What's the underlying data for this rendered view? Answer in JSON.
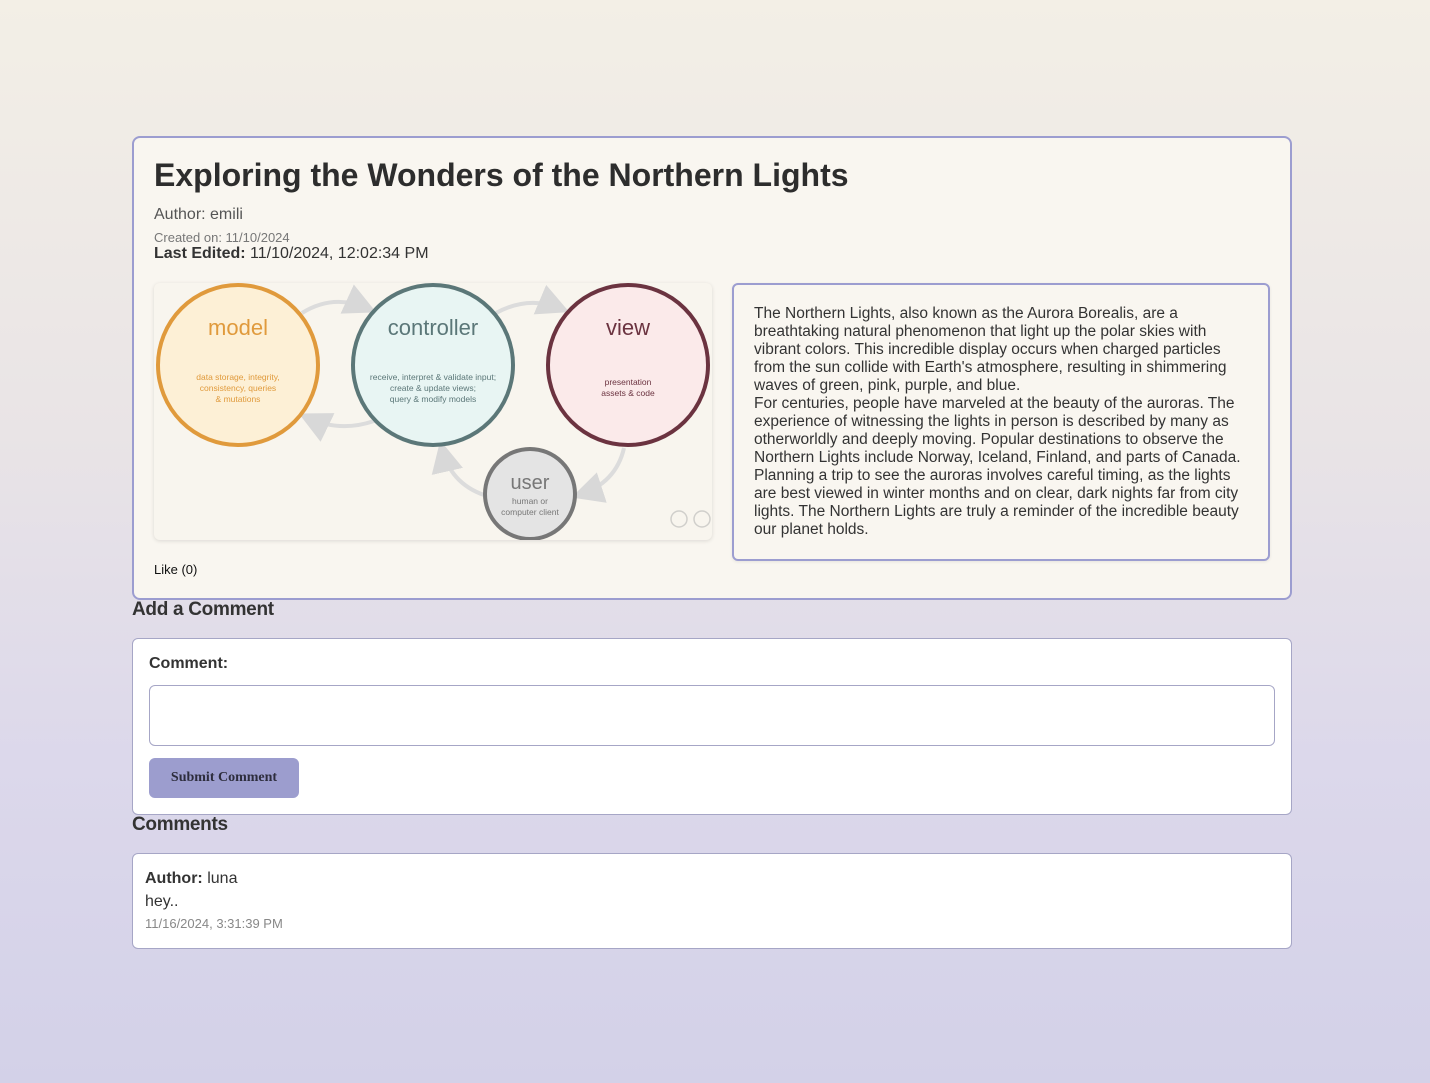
{
  "post": {
    "title": "Exploring the Wonders of the Northern Lights",
    "author": "Author: emili",
    "created": "Created on: 11/10/2024",
    "edited_label": "Last Edited:",
    "edited_value": "11/10/2024, 12:02:34 PM",
    "like_label": "Like (0)",
    "paragraphs": [
      "The Northern Lights, also known as the Aurora Borealis, are a breathtaking natural phenomenon that light up the polar skies with vibrant colors. This incredible display occurs when charged particles from the sun collide with Earth's atmosphere, resulting in shimmering waves of green, pink, purple, and blue.",
      "For centuries, people have marveled at the beauty of the auroras. The experience of witnessing the lights in person is described by many as otherworldly and deeply moving. Popular destinations to observe the Northern Lights include Norway, Iceland, Finland, and parts of Canada. Planning a trip to see the auroras involves careful timing, as the lights are best viewed in winter months and on clear, dark nights far from city lights. The Northern Lights are truly a reminder of the incredible beauty our planet holds."
    ]
  },
  "diagram": {
    "model": {
      "title": "model",
      "lines": [
        "data storage, integrity,",
        "consistency, queries",
        "& mutations"
      ],
      "color": "#e09a3c",
      "fill": "#fdf0d6"
    },
    "controller": {
      "title": "controller",
      "lines": [
        "receive, interpret & validate input;",
        "create & update views;",
        "query & modify models"
      ],
      "color": "#5b7778",
      "fill": "#e8f5f3"
    },
    "view": {
      "title": "view",
      "lines": [
        "presentation",
        "assets & code"
      ],
      "color": "#6b3340",
      "fill": "#fbeaea"
    },
    "user": {
      "title": "user",
      "lines": [
        "human or",
        "computer client"
      ],
      "color": "#777777",
      "fill": "#e4e4e4"
    }
  },
  "add_comment": {
    "heading": "Add a Comment",
    "label": "Comment:",
    "placeholder": "",
    "value": "",
    "submit_label": "Submit Comment"
  },
  "comments": {
    "heading": "Comments",
    "items": [
      {
        "author_label": "Author:",
        "author": "luna",
        "text": "hey..",
        "time": "11/16/2024, 3:31:39 PM"
      }
    ]
  },
  "colors": {
    "accent": "#9c9dce",
    "border": "#9c9dd0"
  }
}
